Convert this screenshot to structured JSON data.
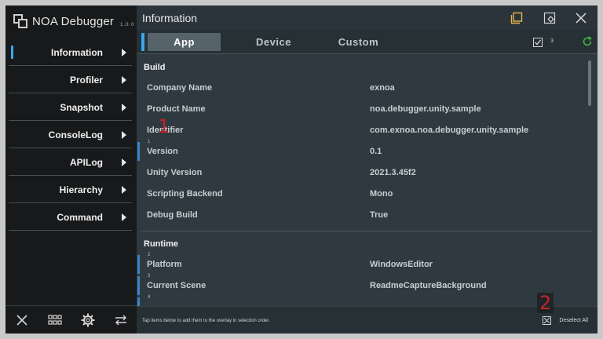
{
  "app": {
    "name": "NOA Debugger",
    "version": "1.0.0"
  },
  "sidebar": {
    "items": [
      {
        "label": "Information",
        "active": true
      },
      {
        "label": "Profiler"
      },
      {
        "label": "Snapshot"
      },
      {
        "label": "ConsoleLog"
      },
      {
        "label": "APILog"
      },
      {
        "label": "Hierarchy"
      },
      {
        "label": "Command"
      }
    ],
    "bottom_icons": [
      "close-icon",
      "grid-icon",
      "gear-icon",
      "swap-icon"
    ]
  },
  "header": {
    "title": "Information",
    "icons": [
      "window-icon",
      "settings-window-icon",
      "close-icon"
    ]
  },
  "tabs": [
    {
      "label": "App",
      "active": true
    },
    {
      "label": "Device"
    },
    {
      "label": "Custom"
    }
  ],
  "tab_right": {
    "checked_count": "3",
    "icons": [
      "checkbox-icon",
      "refresh-icon"
    ]
  },
  "sections": {
    "build": {
      "title": "Build",
      "rows": [
        {
          "key": "Company Name",
          "value": "exnoa"
        },
        {
          "key": "Product Name",
          "value": "noa.debugger.unity.sample"
        },
        {
          "key": "Identifier",
          "value": "com.exnoa.noa.debugger.unity.sample"
        },
        {
          "key": "Version",
          "value": "0.1",
          "order": "1"
        },
        {
          "key": "Unity Version",
          "value": "2021.3.45f2"
        },
        {
          "key": "Scripting Backend",
          "value": "Mono"
        },
        {
          "key": "Debug Build",
          "value": "True"
        }
      ]
    },
    "runtime": {
      "title": "Runtime",
      "rows": [
        {
          "key": "Platform",
          "value": "WindowsEditor",
          "order": "2"
        },
        {
          "key": "Current Scene",
          "value": "ReadmeCaptureBackground",
          "order": "3"
        },
        {
          "key": "",
          "value": "",
          "order": "4"
        }
      ]
    }
  },
  "footer": {
    "hint": "Tap items below to add them to the overlay in selection order.",
    "deselect_label": "Deselect All"
  },
  "markers": {
    "m1": "1",
    "m2": "2"
  },
  "colors": {
    "accent": "#3aa7f0",
    "window_icon": "#e8b84a",
    "refresh_icon": "#3bbf3b",
    "marker": "#c0232b"
  }
}
